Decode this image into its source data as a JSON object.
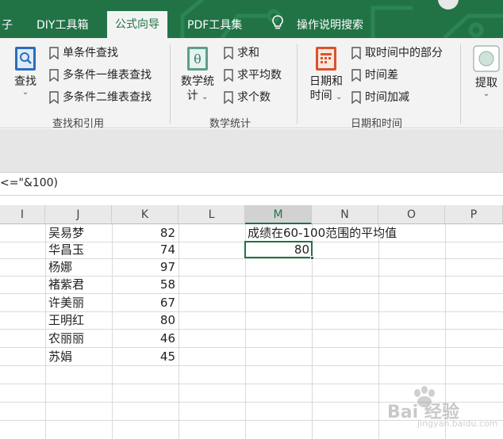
{
  "tabs": [
    {
      "label": "子"
    },
    {
      "label": "DIY工具箱"
    },
    {
      "label": "公式向导"
    },
    {
      "label": "PDF工具集"
    },
    {
      "label": "操作说明搜索"
    }
  ],
  "ribbon": {
    "lookup": {
      "big_label": "查找",
      "items": [
        "单条件查找",
        "多条件一维表查找",
        "多条件二维表查找"
      ],
      "group_label": "查找和引用"
    },
    "math": {
      "big_label_1": "数学统",
      "big_label_2": "计",
      "items": [
        "求和",
        "求平均数",
        "求个数"
      ],
      "group_label": "数学统计"
    },
    "datetime": {
      "big_label_1": "日期和",
      "big_label_2": "时间",
      "items": [
        "取时间中的部分",
        "时间差",
        "时间加减"
      ],
      "group_label": "日期和时间"
    },
    "extract": {
      "big_label": "提取"
    }
  },
  "formula_bar": {
    "text": "<=\"&100)"
  },
  "columns": [
    "I",
    "J",
    "K",
    "L",
    "M",
    "N",
    "O",
    "P"
  ],
  "selected_column": "M",
  "rows": [
    {
      "name": "吴易梦",
      "score": "82"
    },
    {
      "name": "华昌玉",
      "score": "74"
    },
    {
      "name": "杨娜",
      "score": "97"
    },
    {
      "name": "褚紫君",
      "score": "58"
    },
    {
      "name": "许美丽",
      "score": "67"
    },
    {
      "name": "王明红",
      "score": "80"
    },
    {
      "name": "农丽丽",
      "score": "46"
    },
    {
      "name": "苏娟",
      "score": "45"
    }
  ],
  "result": {
    "label": "成绩在60-100范围的平均值",
    "value": "80"
  },
  "watermark": {
    "text": "Bai 经验",
    "sub": "jingyan.baidu.com"
  },
  "colors": {
    "brand": "#217346",
    "ribbon_bg": "#f3f3f3"
  }
}
